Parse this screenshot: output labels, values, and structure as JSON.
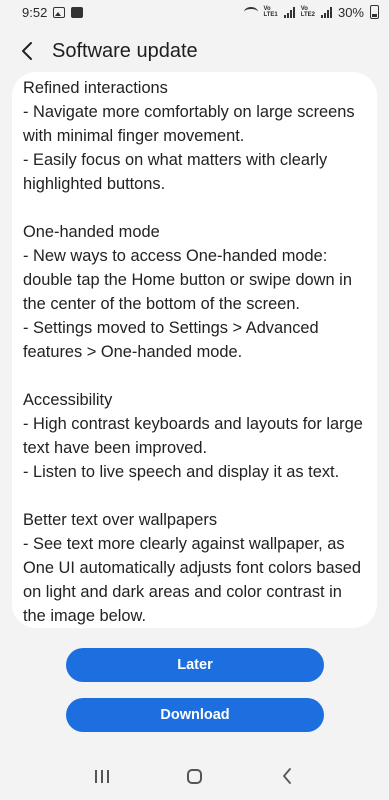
{
  "status_bar": {
    "time": "9:52",
    "net1": "VoLTE1",
    "net2": "VoLTE2",
    "battery": "30%"
  },
  "header": {
    "title": "Software update"
  },
  "content": {
    "sections": [
      {
        "title": "Refined interactions",
        "lines": [
          "- Navigate more comfortably on large screens",
          "with minimal finger movement.",
          "- Easily focus on what matters with clearly",
          "highlighted buttons."
        ]
      },
      {
        "title": "One-handed mode",
        "lines": [
          "- New ways to access One-handed mode:",
          "double tap the Home button or swipe down in",
          "the center of the bottom of the screen.",
          "- Settings moved to Settings > Advanced",
          "features > One-handed mode."
        ]
      },
      {
        "title": "Accessibility",
        "lines": [
          "- High contrast keyboards and layouts for large",
          "text have been improved.",
          "- Listen to live speech and display it as text."
        ]
      },
      {
        "title": "Better text over wallpapers",
        "lines": [
          "- See text more clearly against wallpaper, as",
          "One UI automatically adjusts font colors based",
          "on light and dark areas and color contrast in",
          "the image below."
        ]
      }
    ]
  },
  "actions": {
    "later_label": "Later",
    "download_label": "Download"
  },
  "colors": {
    "accent": "#1d6fe0",
    "background": "#f3f3f3",
    "card": "#ffffff"
  }
}
